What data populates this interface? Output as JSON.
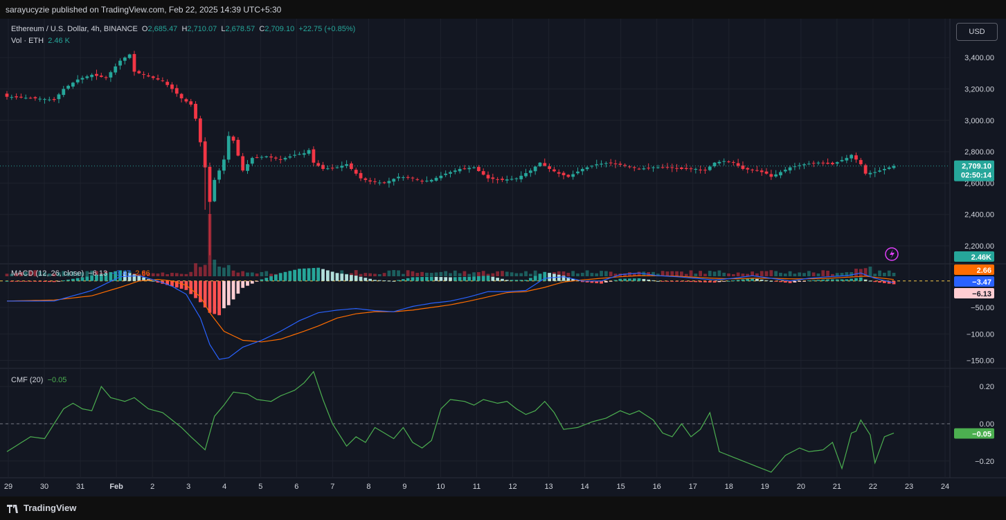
{
  "header": {
    "published": "sarayucyzie published on TradingView.com, Feb 22, 2025 14:39 UTC+5:30"
  },
  "legend": {
    "symbol": "Ethereum / U.S. Dollar, 4h, BINANCE",
    "o_label": "O",
    "o": "2,685.47",
    "h_label": "H",
    "h": "2,710.07",
    "l_label": "L",
    "l": "2,678.57",
    "c_label": "C",
    "c": "2,709.10",
    "change": "+22.75 (+0.85%)",
    "vol_label": "Vol · ETH",
    "vol": "2.46 K"
  },
  "currency": "USD",
  "macd_legend": {
    "label": "MACD (12, 26, close)",
    "hist": "−6.13",
    "macd": "−3.47",
    "signal": "2.66"
  },
  "cmf_legend": {
    "label": "CMF (20)",
    "value": "−0.05"
  },
  "price_badge": {
    "price": "2,709.10",
    "countdown": "02:50:14"
  },
  "volume_badge": "2.46K",
  "macd_badges": {
    "signal": "2.66",
    "macd": "−3.47",
    "hist": "−6.13"
  },
  "cmf_badge": "−0.05",
  "colors": {
    "up": "#26a69a",
    "down": "#f23645",
    "macd": "#2962ff",
    "signal": "#ff6d00",
    "cmf": "#4caf50",
    "background": "#131722"
  },
  "footer": {
    "brand": "TradingView"
  },
  "chart_data": [
    {
      "type": "candlestick",
      "title": "Ethereum / U.S. Dollar, 4h, BINANCE",
      "price_ticks": [
        "3,400.00",
        "3,200.00",
        "3,000.00",
        "2,800.00",
        "2,600.00",
        "2,400.00",
        "2,200.00"
      ],
      "price_tick_values": [
        3400,
        3200,
        3000,
        2800,
        2600,
        2400,
        2200
      ],
      "ylim": [
        2050,
        3480
      ],
      "x_ticks": [
        "29",
        "30",
        "31",
        "Feb",
        "2",
        "3",
        "4",
        "5",
        "6",
        "7",
        "8",
        "9",
        "10",
        "11",
        "12",
        "13",
        "14",
        "15",
        "16",
        "17",
        "18",
        "19",
        "20",
        "21",
        "22",
        "23",
        "24"
      ],
      "anchors": [
        [
          0,
          3150
        ],
        [
          6,
          3140
        ],
        [
          10,
          3130
        ],
        [
          12,
          3200
        ],
        [
          15,
          3260
        ],
        [
          18,
          3290
        ],
        [
          21,
          3270
        ],
        [
          24,
          3380
        ],
        [
          26,
          3420
        ],
        [
          27,
          3310
        ],
        [
          30,
          3280
        ],
        [
          33,
          3250
        ],
        [
          35,
          3200
        ],
        [
          37,
          3140
        ],
        [
          39,
          3100
        ],
        [
          40,
          3010
        ],
        [
          41,
          2860
        ],
        [
          42,
          2700
        ],
        [
          43,
          2480
        ],
        [
          44,
          2620
        ],
        [
          45,
          2680
        ],
        [
          46,
          2750
        ],
        [
          47,
          2900
        ],
        [
          48,
          2870
        ],
        [
          50,
          2680
        ],
        [
          52,
          2760
        ],
        [
          55,
          2770
        ],
        [
          58,
          2750
        ],
        [
          61,
          2780
        ],
        [
          63,
          2790
        ],
        [
          64,
          2810
        ],
        [
          65,
          2730
        ],
        [
          67,
          2690
        ],
        [
          70,
          2700
        ],
        [
          72,
          2720
        ],
        [
          73,
          2690
        ],
        [
          75,
          2630
        ],
        [
          77,
          2610
        ],
        [
          80,
          2600
        ],
        [
          83,
          2640
        ],
        [
          86,
          2630
        ],
        [
          88,
          2610
        ],
        [
          90,
          2620
        ],
        [
          93,
          2660
        ],
        [
          96,
          2690
        ],
        [
          99,
          2700
        ],
        [
          102,
          2630
        ],
        [
          105,
          2620
        ],
        [
          108,
          2630
        ],
        [
          111,
          2680
        ],
        [
          113,
          2730
        ],
        [
          115,
          2690
        ],
        [
          117,
          2660
        ],
        [
          119,
          2640
        ],
        [
          122,
          2690
        ],
        [
          125,
          2720
        ],
        [
          128,
          2730
        ],
        [
          131,
          2710
        ],
        [
          134,
          2690
        ],
        [
          137,
          2700
        ],
        [
          140,
          2700
        ],
        [
          143,
          2690
        ],
        [
          146,
          2690
        ],
        [
          148,
          2680
        ],
        [
          150,
          2730
        ],
        [
          152,
          2740
        ],
        [
          154,
          2730
        ],
        [
          156,
          2690
        ],
        [
          159,
          2680
        ],
        [
          161,
          2660
        ],
        [
          162,
          2640
        ],
        [
          164,
          2670
        ],
        [
          166,
          2700
        ],
        [
          169,
          2720
        ],
        [
          172,
          2730
        ],
        [
          175,
          2720
        ],
        [
          178,
          2760
        ],
        [
          179,
          2780
        ],
        [
          181,
          2720
        ],
        [
          182,
          2660
        ],
        [
          184,
          2670
        ],
        [
          186,
          2690
        ],
        [
          188,
          2709
        ]
      ],
      "volume_spike": {
        "index": 43,
        "value": "3.7K"
      }
    },
    {
      "type": "line",
      "title": "MACD (12, 26, close)",
      "yticks": [
        "−50.00",
        "−100.00",
        "−150.00"
      ],
      "ytick_values": [
        -50,
        -100,
        -150
      ],
      "ylim": [
        -165,
        35
      ],
      "series": [
        {
          "name": "MACD",
          "anchors": [
            [
              0,
              -38
            ],
            [
              10,
              -38
            ],
            [
              18,
              -18
            ],
            [
              24,
              8
            ],
            [
              28,
              10
            ],
            [
              32,
              0
            ],
            [
              35,
              -10
            ],
            [
              38,
              -25
            ],
            [
              41,
              -70
            ],
            [
              43,
              -120
            ],
            [
              45,
              -148
            ],
            [
              47,
              -145
            ],
            [
              50,
              -125
            ],
            [
              54,
              -112
            ],
            [
              58,
              -95
            ],
            [
              62,
              -75
            ],
            [
              66,
              -60
            ],
            [
              70,
              -55
            ],
            [
              74,
              -52
            ],
            [
              78,
              -56
            ],
            [
              82,
              -58
            ],
            [
              86,
              -48
            ],
            [
              90,
              -42
            ],
            [
              94,
              -38
            ],
            [
              98,
              -30
            ],
            [
              102,
              -20
            ],
            [
              106,
              -20
            ],
            [
              110,
              -18
            ],
            [
              114,
              5
            ],
            [
              118,
              8
            ],
            [
              122,
              0
            ],
            [
              126,
              0
            ],
            [
              130,
              12
            ],
            [
              134,
              15
            ],
            [
              138,
              10
            ],
            [
              142,
              8
            ],
            [
              146,
              5
            ],
            [
              150,
              2
            ],
            [
              154,
              5
            ],
            [
              158,
              10
            ],
            [
              162,
              5
            ],
            [
              166,
              0
            ],
            [
              170,
              5
            ],
            [
              174,
              8
            ],
            [
              178,
              10
            ],
            [
              181,
              15
            ],
            [
              184,
              5
            ],
            [
              188,
              -3.47
            ]
          ]
        },
        {
          "name": "Signal",
          "anchors": [
            [
              0,
              -38
            ],
            [
              10,
              -36
            ],
            [
              18,
              -28
            ],
            [
              24,
              -12
            ],
            [
              28,
              0
            ],
            [
              32,
              3
            ],
            [
              35,
              0
            ],
            [
              38,
              -8
            ],
            [
              41,
              -30
            ],
            [
              43,
              -60
            ],
            [
              46,
              -95
            ],
            [
              50,
              -112
            ],
            [
              54,
              -115
            ],
            [
              58,
              -110
            ],
            [
              62,
              -98
            ],
            [
              66,
              -85
            ],
            [
              70,
              -70
            ],
            [
              74,
              -62
            ],
            [
              78,
              -58
            ],
            [
              82,
              -58
            ],
            [
              86,
              -55
            ],
            [
              90,
              -50
            ],
            [
              94,
              -45
            ],
            [
              98,
              -38
            ],
            [
              102,
              -30
            ],
            [
              106,
              -22
            ],
            [
              110,
              -20
            ],
            [
              114,
              -12
            ],
            [
              118,
              -2
            ],
            [
              122,
              2
            ],
            [
              126,
              5
            ],
            [
              130,
              8
            ],
            [
              134,
              10
            ],
            [
              138,
              10
            ],
            [
              142,
              9
            ],
            [
              146,
              7
            ],
            [
              150,
              5
            ],
            [
              154,
              4
            ],
            [
              158,
              5
            ],
            [
              162,
              5
            ],
            [
              166,
              4
            ],
            [
              170,
              4
            ],
            [
              174,
              5
            ],
            [
              178,
              7
            ],
            [
              182,
              9
            ],
            [
              188,
              2.66
            ]
          ]
        }
      ],
      "histogram": "macd_minus_signal"
    },
    {
      "type": "line",
      "title": "CMF (20)",
      "yticks": [
        "0.20",
        "0.00",
        "−0.20"
      ],
      "ytick_values": [
        0.2,
        0.0,
        -0.2
      ],
      "ylim": [
        -0.29,
        0.29
      ],
      "series": [
        {
          "name": "CMF",
          "anchors": [
            [
              0,
              -0.15
            ],
            [
              5,
              -0.07
            ],
            [
              8,
              -0.08
            ],
            [
              12,
              0.08
            ],
            [
              14,
              0.11
            ],
            [
              16,
              0.08
            ],
            [
              18,
              0.07
            ],
            [
              20,
              0.2
            ],
            [
              22,
              0.14
            ],
            [
              25,
              0.12
            ],
            [
              27,
              0.14
            ],
            [
              30,
              0.08
            ],
            [
              33,
              0.06
            ],
            [
              35,
              0.02
            ],
            [
              37,
              -0.02
            ],
            [
              39,
              -0.07
            ],
            [
              42,
              -0.14
            ],
            [
              44,
              0.04
            ],
            [
              46,
              0.1
            ],
            [
              48,
              0.17
            ],
            [
              51,
              0.16
            ],
            [
              53,
              0.13
            ],
            [
              56,
              0.12
            ],
            [
              58,
              0.15
            ],
            [
              61,
              0.18
            ],
            [
              63,
              0.22
            ],
            [
              65,
              0.28
            ],
            [
              67,
              0.13
            ],
            [
              69,
              0.0
            ],
            [
              72,
              -0.12
            ],
            [
              74,
              -0.07
            ],
            [
              76,
              -0.1
            ],
            [
              78,
              -0.02
            ],
            [
              80,
              -0.05
            ],
            [
              82,
              -0.08
            ],
            [
              84,
              -0.02
            ],
            [
              86,
              -0.1
            ],
            [
              88,
              -0.13
            ],
            [
              90,
              -0.09
            ],
            [
              92,
              0.08
            ],
            [
              94,
              0.13
            ],
            [
              97,
              0.12
            ],
            [
              99,
              0.1
            ],
            [
              101,
              0.13
            ],
            [
              104,
              0.11
            ],
            [
              106,
              0.12
            ],
            [
              108,
              0.08
            ],
            [
              110,
              0.05
            ],
            [
              112,
              0.07
            ],
            [
              114,
              0.12
            ],
            [
              116,
              0.06
            ],
            [
              118,
              -0.03
            ],
            [
              121,
              -0.02
            ],
            [
              124,
              0.01
            ],
            [
              127,
              0.03
            ],
            [
              130,
              0.07
            ],
            [
              132,
              0.05
            ],
            [
              134,
              0.07
            ],
            [
              137,
              0.02
            ],
            [
              139,
              -0.05
            ],
            [
              141,
              -0.07
            ],
            [
              143,
              0.0
            ],
            [
              145,
              -0.07
            ],
            [
              147,
              -0.03
            ],
            [
              149,
              0.06
            ],
            [
              151,
              -0.15
            ],
            [
              153,
              -0.17
            ],
            [
              156,
              -0.2
            ],
            [
              159,
              -0.23
            ],
            [
              162,
              -0.26
            ],
            [
              165,
              -0.17
            ],
            [
              168,
              -0.13
            ],
            [
              170,
              -0.15
            ],
            [
              173,
              -0.14
            ],
            [
              175,
              -0.1
            ],
            [
              177,
              -0.24
            ],
            [
              179,
              -0.05
            ],
            [
              180,
              -0.04
            ],
            [
              181,
              0.02
            ],
            [
              183,
              -0.06
            ],
            [
              184,
              -0.21
            ],
            [
              186,
              -0.07
            ],
            [
              188,
              -0.05
            ]
          ]
        }
      ]
    }
  ]
}
